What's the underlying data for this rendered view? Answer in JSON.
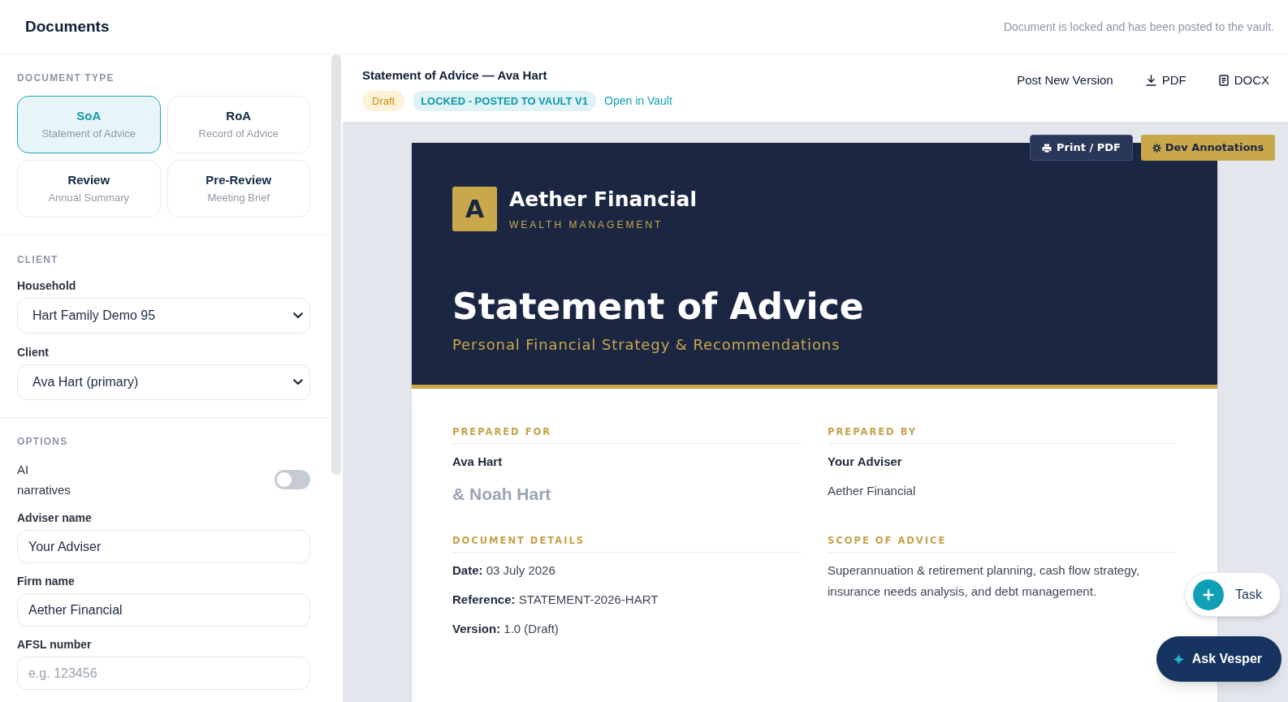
{
  "header": {
    "title": "Documents",
    "status_message": "Document is locked and has been posted to the vault."
  },
  "sidebar": {
    "document_type": {
      "heading": "DOCUMENT TYPE",
      "types": [
        {
          "code": "SoA",
          "description": "Statement of Advice",
          "selected": true
        },
        {
          "code": "RoA",
          "description": "Record of Advice",
          "selected": false
        },
        {
          "code": "Review",
          "description": "Annual Summary",
          "selected": false
        },
        {
          "code": "Pre-Review",
          "description": "Meeting Brief",
          "selected": false
        }
      ]
    },
    "client": {
      "heading": "CLIENT",
      "fields": [
        {
          "label": "Household",
          "value": "Hart Family Demo 95"
        },
        {
          "label": "Client",
          "value": "Ava Hart (primary)"
        }
      ]
    },
    "options": {
      "heading": "OPTIONS",
      "items": [
        {
          "kind": "toggle",
          "label": "AI narratives",
          "on": false
        },
        {
          "kind": "text",
          "label": "Adviser name",
          "value": "Your Adviser"
        },
        {
          "kind": "text",
          "label": "Firm name",
          "value": "Aether Financial"
        },
        {
          "kind": "text",
          "label": "AFSL number",
          "placeholder": "e.g. 123456"
        }
      ]
    }
  },
  "document_bar": {
    "title": "Statement of Advice — Ava Hart",
    "badges": [
      {
        "kind": "draft",
        "text": "Draft"
      },
      {
        "kind": "locked",
        "text": "LOCKED - POSTED TO VAULT V1"
      }
    ],
    "link": "Open in Vault",
    "actions": [
      {
        "kind": "text",
        "label": "Post New Version"
      },
      {
        "kind": "download",
        "label": "PDF"
      },
      {
        "kind": "document",
        "label": "DOCX"
      }
    ]
  },
  "preview": {
    "toolbar": [
      {
        "kind": "print",
        "label": "Print / PDF"
      },
      {
        "kind": "settings",
        "label": "Dev Annotations"
      }
    ],
    "document": {
      "logo_letter": "A",
      "firm_name": "Aether Financial",
      "tagline": "WEALTH MANAGEMENT",
      "title": "Statement of Advice",
      "subtitle": "Personal Financial Strategy & Recommendations",
      "sections": [
        {
          "heading": "PREPARED FOR",
          "lines": [
            {
              "kind": "name",
              "text": "Ava Hart"
            },
            {
              "kind": "secondary_name",
              "text": "& Noah Hart"
            }
          ]
        },
        {
          "heading": "PREPARED BY",
          "lines": [
            {
              "kind": "name",
              "text": "Your Adviser"
            },
            {
              "kind": "plain",
              "text": "Aether Financial"
            }
          ]
        },
        {
          "heading": "DOCUMENT DETAILS",
          "lines": [
            {
              "kind": "plain",
              "text": "**Date:** 03 July 2026"
            },
            {
              "kind": "plain",
              "text": "**Reference:** STATEMENT-2026-HART"
            },
            {
              "kind": "plain",
              "text": "**Version:** 1.0 (Draft)"
            }
          ]
        },
        {
          "heading": "SCOPE OF ADVICE",
          "lines": [
            {
              "kind": "paragraph",
              "text": "Superannuation & retirement planning, cash flow strategy, insurance needs analysis, and debt management."
            }
          ]
        }
      ]
    }
  },
  "floating_actions": [
    {
      "kind": "task",
      "label": "Task"
    },
    {
      "kind": "assistant",
      "label": "Ask Vesper"
    }
  ]
}
